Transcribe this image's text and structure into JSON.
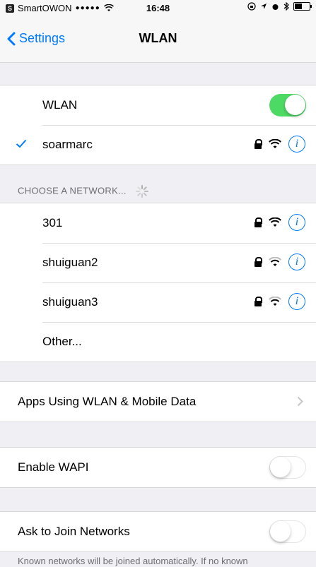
{
  "status_bar": {
    "carrier": "SmartOWON",
    "signal": "●●●●●",
    "time": "16:48"
  },
  "nav": {
    "back_label": "Settings",
    "title": "WLAN"
  },
  "wlan_group": {
    "wlan_label": "WLAN",
    "wlan_on": true,
    "connected_network": "soarmarc"
  },
  "networks": {
    "header": "CHOOSE A NETWORK...",
    "items": [
      {
        "name": "301"
      },
      {
        "name": "shuiguan2"
      },
      {
        "name": "shuiguan3"
      }
    ],
    "other_label": "Other..."
  },
  "apps_group": {
    "label": "Apps Using WLAN & Mobile Data"
  },
  "wapi_group": {
    "label": "Enable WAPI",
    "enabled": false
  },
  "ask_group": {
    "label": "Ask to Join Networks",
    "enabled": false
  },
  "footer": {
    "text": "Known networks will be joined automatically. If no known"
  },
  "colors": {
    "accent": "#007aff",
    "toggle_on": "#4cd964",
    "background": "#efeff4"
  }
}
